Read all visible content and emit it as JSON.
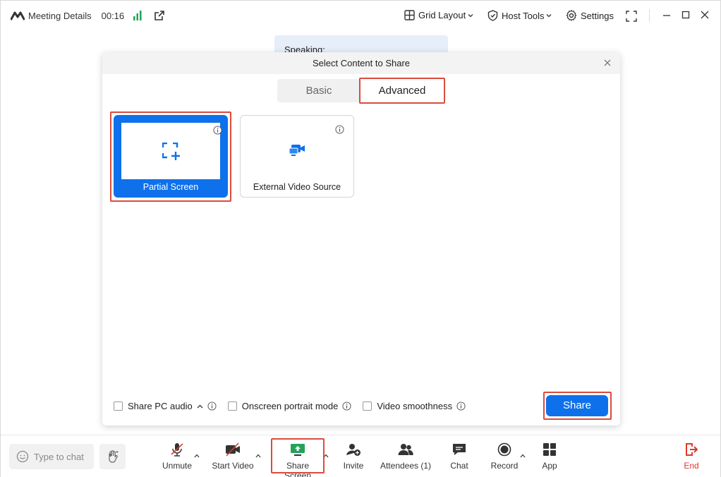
{
  "topbar": {
    "title": "Meeting Details",
    "timer": "00:16",
    "grid_layout": "Grid Layout",
    "host_tools": "Host Tools",
    "settings": "Settings"
  },
  "speaking": {
    "label": "Speaking:"
  },
  "dialog": {
    "title": "Select Content to Share",
    "tabs": [
      {
        "label": "Basic",
        "selected": false
      },
      {
        "label": "Advanced",
        "selected": true
      }
    ],
    "cards": [
      {
        "label": "Partial Screen",
        "selected": true
      },
      {
        "label": "External Video Source",
        "selected": false
      }
    ],
    "options": [
      {
        "label": "Share PC audio",
        "checked": false
      },
      {
        "label": "Onscreen portrait mode",
        "checked": false
      },
      {
        "label": "Video smoothness",
        "checked": false
      }
    ],
    "share_button": "Share"
  },
  "bottombar": {
    "chat_placeholder": "Type to chat",
    "tools": [
      {
        "label": "Unmute"
      },
      {
        "label": "Start Video"
      },
      {
        "label": "Share Screen"
      },
      {
        "label": "Invite"
      },
      {
        "label": "Attendees (1)"
      },
      {
        "label": "Chat"
      },
      {
        "label": "Record"
      },
      {
        "label": "App"
      },
      {
        "label": "End"
      }
    ]
  },
  "colors": {
    "accent": "#0e71eb",
    "highlight": "#d94c3d",
    "end": "#e0392b",
    "signal": "#23a35a"
  }
}
